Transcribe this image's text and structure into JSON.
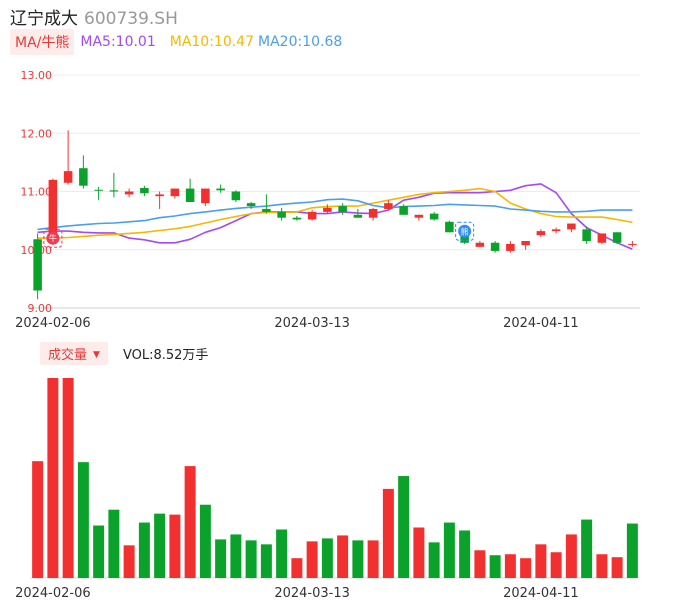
{
  "header": {
    "name": "辽宁成大",
    "code": "600739.SH"
  },
  "legend": {
    "badge": "MA/牛熊",
    "ma5": "MA5:10.01",
    "ma10": "MA10:10.47",
    "ma20": "MA20:10.68"
  },
  "volume_legend": {
    "badge": "成交量",
    "text": "VOL:8.52万手"
  },
  "markers": [
    {
      "text": "牛",
      "index": 1
    },
    {
      "text": "熊",
      "index": 28
    }
  ],
  "colors": {
    "up": "#f23030",
    "down": "#0aa22a",
    "ma5": "#a24bf0",
    "ma10": "#f5b800",
    "ma20": "#4a9fe8"
  },
  "chart_data": [
    {
      "type": "candlestick",
      "yticks": [
        "13.00",
        "12.00",
        "11.00",
        "10.00",
        "9.00"
      ],
      "ylim": [
        9.0,
        13.0
      ],
      "xtick_labels": [
        {
          "index": 1,
          "label": "2024-02-06"
        },
        {
          "index": 18,
          "label": "2024-03-13"
        },
        {
          "index": 33,
          "label": "2024-04-11"
        }
      ],
      "ohlc": [
        [
          10.18,
          10.28,
          9.15,
          9.3
        ],
        [
          10.25,
          11.22,
          10.2,
          11.2
        ],
        [
          11.15,
          12.05,
          11.12,
          11.35
        ],
        [
          11.4,
          11.62,
          11.05,
          11.1
        ],
        [
          11.03,
          11.08,
          10.85,
          11.02
        ],
        [
          11.02,
          11.32,
          10.9,
          11.0
        ],
        [
          10.95,
          11.05,
          10.9,
          11.0
        ],
        [
          11.06,
          11.1,
          10.92,
          10.97
        ],
        [
          10.92,
          11.0,
          10.7,
          10.95
        ],
        [
          10.92,
          11.05,
          10.88,
          11.05
        ],
        [
          11.05,
          11.22,
          10.82,
          10.82
        ],
        [
          10.8,
          11.05,
          10.75,
          11.05
        ],
        [
          11.05,
          11.12,
          10.98,
          11.02
        ],
        [
          11.0,
          11.02,
          10.82,
          10.85
        ],
        [
          10.8,
          10.82,
          10.7,
          10.75
        ],
        [
          10.7,
          10.95,
          10.62,
          10.65
        ],
        [
          10.65,
          10.72,
          10.5,
          10.55
        ],
        [
          10.55,
          10.58,
          10.5,
          10.52
        ],
        [
          10.52,
          10.68,
          10.5,
          10.65
        ],
        [
          10.65,
          10.78,
          10.62,
          10.72
        ],
        [
          10.75,
          10.8,
          10.6,
          10.65
        ],
        [
          10.6,
          10.7,
          10.55,
          10.55
        ],
        [
          10.55,
          10.72,
          10.5,
          10.7
        ],
        [
          10.7,
          10.85,
          10.68,
          10.8
        ],
        [
          10.75,
          10.78,
          10.6,
          10.6
        ],
        [
          10.55,
          10.6,
          10.5,
          10.6
        ],
        [
          10.62,
          10.65,
          10.5,
          10.52
        ],
        [
          10.48,
          10.5,
          10.3,
          10.3
        ],
        [
          10.28,
          10.3,
          10.1,
          10.12
        ],
        [
          10.05,
          10.15,
          10.05,
          10.12
        ],
        [
          10.12,
          10.15,
          9.95,
          9.98
        ],
        [
          9.98,
          10.15,
          9.95,
          10.1
        ],
        [
          10.08,
          10.15,
          10.0,
          10.15
        ],
        [
          10.25,
          10.35,
          10.22,
          10.32
        ],
        [
          10.32,
          10.38,
          10.28,
          10.35
        ],
        [
          10.35,
          10.45,
          10.3,
          10.45
        ],
        [
          10.35,
          10.4,
          10.1,
          10.15
        ],
        [
          10.12,
          10.28,
          10.1,
          10.28
        ],
        [
          10.3,
          10.3,
          10.1,
          10.12
        ],
        [
          10.1,
          10.15,
          10.05,
          10.1
        ]
      ],
      "series": [
        {
          "name": "MA5",
          "values": [
            10.3,
            10.32,
            10.32,
            10.3,
            10.29,
            10.29,
            10.2,
            10.17,
            10.12,
            10.12,
            10.18,
            10.3,
            10.38,
            10.5,
            10.62,
            10.65,
            10.65,
            10.65,
            10.62,
            10.62,
            10.65,
            10.63,
            10.62,
            10.68,
            10.85,
            10.9,
            10.97,
            10.98,
            10.98,
            10.98,
            11.0,
            11.02,
            11.1,
            11.13,
            10.98,
            10.62,
            10.38,
            10.25,
            10.12,
            10.01
          ]
        },
        {
          "name": "MA10",
          "values": [
            10.2,
            10.2,
            10.21,
            10.23,
            10.25,
            10.26,
            10.28,
            10.3,
            10.33,
            10.36,
            10.4,
            10.46,
            10.52,
            10.57,
            10.62,
            10.64,
            10.64,
            10.65,
            10.72,
            10.74,
            10.75,
            10.75,
            10.8,
            10.85,
            10.9,
            10.95,
            10.98,
            11.0,
            11.02,
            11.05,
            11.0,
            10.8,
            10.7,
            10.62,
            10.57,
            10.56,
            10.56,
            10.56,
            10.52,
            10.47
          ]
        },
        {
          "name": "MA20",
          "values": [
            10.35,
            10.38,
            10.41,
            10.43,
            10.45,
            10.46,
            10.48,
            10.5,
            10.55,
            10.58,
            10.62,
            10.65,
            10.68,
            10.71,
            10.73,
            10.75,
            10.78,
            10.8,
            10.82,
            10.86,
            10.87,
            10.84,
            10.76,
            10.72,
            10.74,
            10.75,
            10.76,
            10.78,
            10.77,
            10.76,
            10.75,
            10.7,
            10.68,
            10.66,
            10.65,
            10.65,
            10.66,
            10.68,
            10.68,
            10.68
          ]
        }
      ]
    },
    {
      "type": "bar",
      "name": "成交量",
      "xtick_labels": [
        {
          "index": 1,
          "label": "2024-02-06"
        },
        {
          "index": 18,
          "label": "2024-03-13"
        },
        {
          "index": 33,
          "label": "2024-04-11"
        }
      ],
      "values": [
        11.8,
        20.2,
        20.2,
        11.7,
        5.3,
        6.9,
        3.3,
        5.6,
        6.5,
        6.4,
        11.3,
        7.4,
        3.9,
        4.4,
        3.8,
        3.4,
        4.9,
        2.0,
        3.7,
        4.0,
        4.3,
        3.8,
        3.8,
        9.0,
        10.3,
        5.1,
        3.6,
        5.6,
        4.8,
        2.8,
        2.3,
        2.4,
        2.0,
        3.4,
        2.6,
        4.4,
        5.9,
        2.4,
        2.1,
        5.5
      ],
      "up": [
        true,
        true,
        true,
        false,
        false,
        false,
        true,
        false,
        false,
        true,
        true,
        false,
        false,
        false,
        false,
        false,
        false,
        true,
        true,
        false,
        true,
        false,
        true,
        true,
        false,
        true,
        false,
        false,
        false,
        true,
        false,
        true,
        true,
        true,
        true,
        true,
        false,
        true,
        true,
        false
      ]
    }
  ]
}
